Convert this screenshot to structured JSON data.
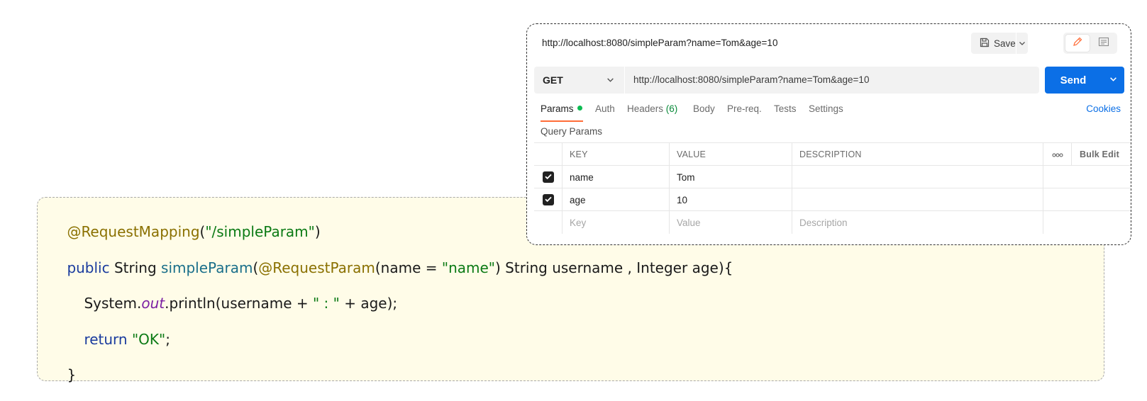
{
  "code": {
    "line1": {
      "annotation": "@RequestMapping",
      "open": "(",
      "path": "\"/simpleParam\"",
      "close": ")"
    },
    "line2": {
      "kw_public": "public",
      "type_string": " String ",
      "method": "simpleParam",
      "paren_open": "(",
      "annotation": "@RequestParam",
      "arg_open": "(name = ",
      "arg_value": "\"name\"",
      "rest": ") String username , Integer age){"
    },
    "line3": {
      "prefix": "System.",
      "field": "out",
      "call": ".println(username + ",
      "sep": "\" : \"",
      "end": " + age);"
    },
    "line4": {
      "kw_return": "return",
      "space": " ",
      "value": "\"OK\"",
      "semi": ";"
    },
    "line5": {
      "brace": "}"
    }
  },
  "postman": {
    "title": "http://localhost:8080/simpleParam?name=Tom&age=10",
    "save_label": "Save",
    "method": "GET",
    "url": "http://localhost:8080/simpleParam?name=Tom&age=10",
    "send_label": "Send",
    "tabs": {
      "params": "Params",
      "auth": "Auth",
      "headers": "Headers",
      "headers_count": "(6)",
      "body": "Body",
      "prereq": "Pre-req.",
      "tests": "Tests",
      "settings": "Settings"
    },
    "cookies": "Cookies",
    "query_params_label": "Query Params",
    "table": {
      "headers": {
        "key": "KEY",
        "value": "VALUE",
        "description": "DESCRIPTION",
        "more": "ooo",
        "bulk_edit": "Bulk Edit"
      },
      "rows": [
        {
          "key": "name",
          "value": "Tom",
          "description": "",
          "checked": true
        },
        {
          "key": "age",
          "value": "10",
          "description": "",
          "checked": true
        }
      ],
      "placeholders": {
        "key": "Key",
        "value": "Value",
        "description": "Description"
      }
    },
    "colors": {
      "send": "#0b6fe6",
      "active_tab_underline": "#ff6c37",
      "params_dot": "#0cbb52"
    }
  }
}
